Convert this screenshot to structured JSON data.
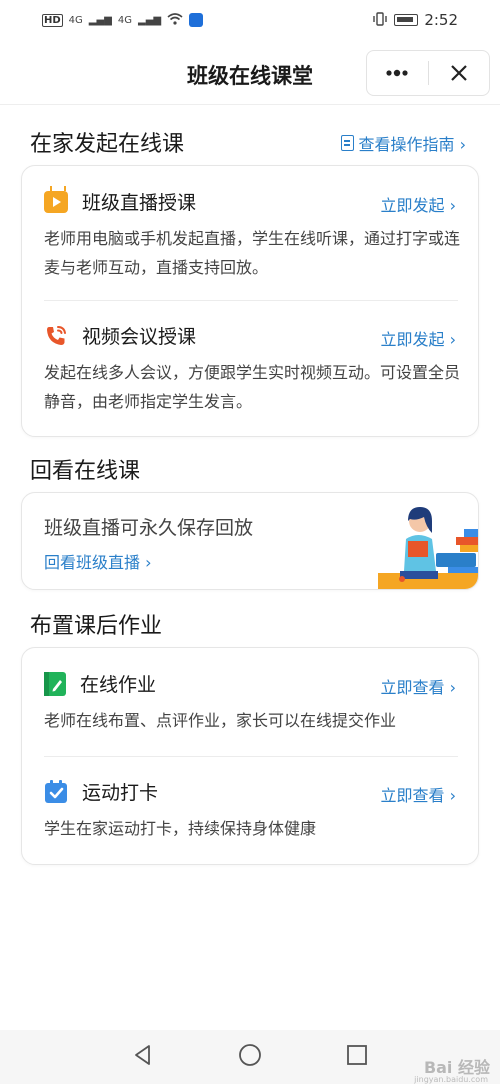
{
  "status_bar": {
    "network_badge": "HD",
    "signal_1": "4G",
    "signal_2": "4G",
    "time": "2:52"
  },
  "header": {
    "title": "班级在线课堂",
    "more_icon": "more-dots-icon",
    "close_icon": "close-icon"
  },
  "section_online": {
    "title": "在家发起在线课",
    "guide_link": "查看操作指南 ›",
    "items": [
      {
        "icon": "tv-play-icon",
        "title": "班级直播授课",
        "action": "立即发起 ›",
        "desc": "老师用电脑或手机发起直播，学生在线听课，通过打字或连麦与老师互动，直播支持回放。"
      },
      {
        "icon": "video-call-icon",
        "title": "视频会议授课",
        "action": "立即发起 ›",
        "desc": "发起在线多人会议，方便跟学生实时视频互动。可设置全员静音，由老师指定学生发言。"
      }
    ]
  },
  "section_playback": {
    "title": "回看在线课",
    "card_text": "班级直播可永久保存回放",
    "card_link": "回看班级直播 ›"
  },
  "section_homework": {
    "title": "布置课后作业",
    "items": [
      {
        "icon": "homework-icon",
        "title": "在线作业",
        "action": "立即查看 ›",
        "desc": "老师在线布置、点评作业，家长可以在线提交作业"
      },
      {
        "icon": "checkin-icon",
        "title": "运动打卡",
        "action": "立即查看 ›",
        "desc": "学生在家运动打卡，持续保持身体健康"
      }
    ]
  },
  "system_nav": {
    "back_icon": "back-triangle-icon",
    "home_icon": "home-circle-icon",
    "recents_icon": "recents-square-icon"
  },
  "watermark": {
    "text": "Bai 经验",
    "sub": "jingyan.baidu.com"
  },
  "colors": {
    "accent": "#2a7fc9",
    "orange": "#f5a623",
    "red_orange": "#e8562a",
    "green": "#21b35a",
    "blue_check": "#3b8de6"
  }
}
